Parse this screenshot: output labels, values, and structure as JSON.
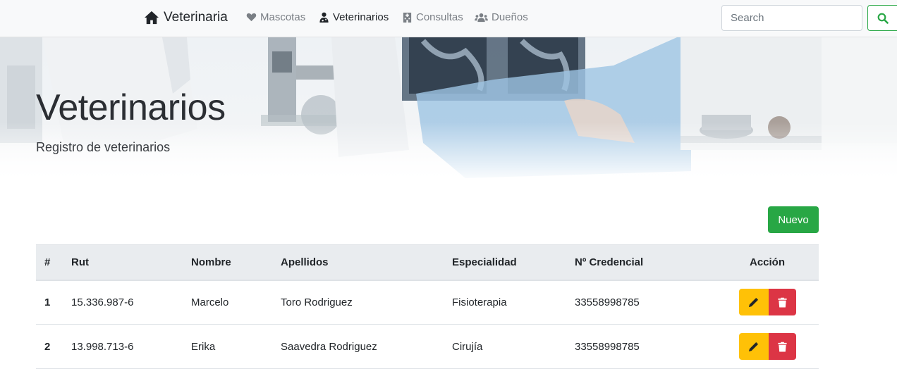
{
  "nav": {
    "brand": "Veterinaria",
    "items": [
      {
        "label": "Mascotas",
        "icon": "heart-icon"
      },
      {
        "label": "Veterinarios",
        "icon": "user-md-icon"
      },
      {
        "label": "Consultas",
        "icon": "hospital-icon"
      },
      {
        "label": "Dueños",
        "icon": "users-icon"
      }
    ],
    "search_placeholder": "Search"
  },
  "hero": {
    "title": "Veterinarios",
    "subtitle": "Registro de veterinarios"
  },
  "new_button": "Nuevo",
  "table": {
    "headers": [
      "#",
      "Rut",
      "Nombre",
      "Apellidos",
      "Especialidad",
      "Nº Credencial",
      "Acción"
    ],
    "rows": [
      {
        "num": "1",
        "rut": "15.336.987-6",
        "nombre": "Marcelo",
        "apellidos": "Toro Rodriguez",
        "especialidad": "Fisioterapia",
        "credencial": "33558998785"
      },
      {
        "num": "2",
        "rut": "13.998.713-6",
        "nombre": "Erika",
        "apellidos": "Saavedra Rodriguez",
        "especialidad": "Cirujía",
        "credencial": "33558998785"
      }
    ]
  },
  "colors": {
    "success": "#28a745",
    "warning": "#ffc107",
    "danger": "#dc3545",
    "navbar_bg": "#f8f9fa",
    "table_header_bg": "#e9ecef"
  }
}
